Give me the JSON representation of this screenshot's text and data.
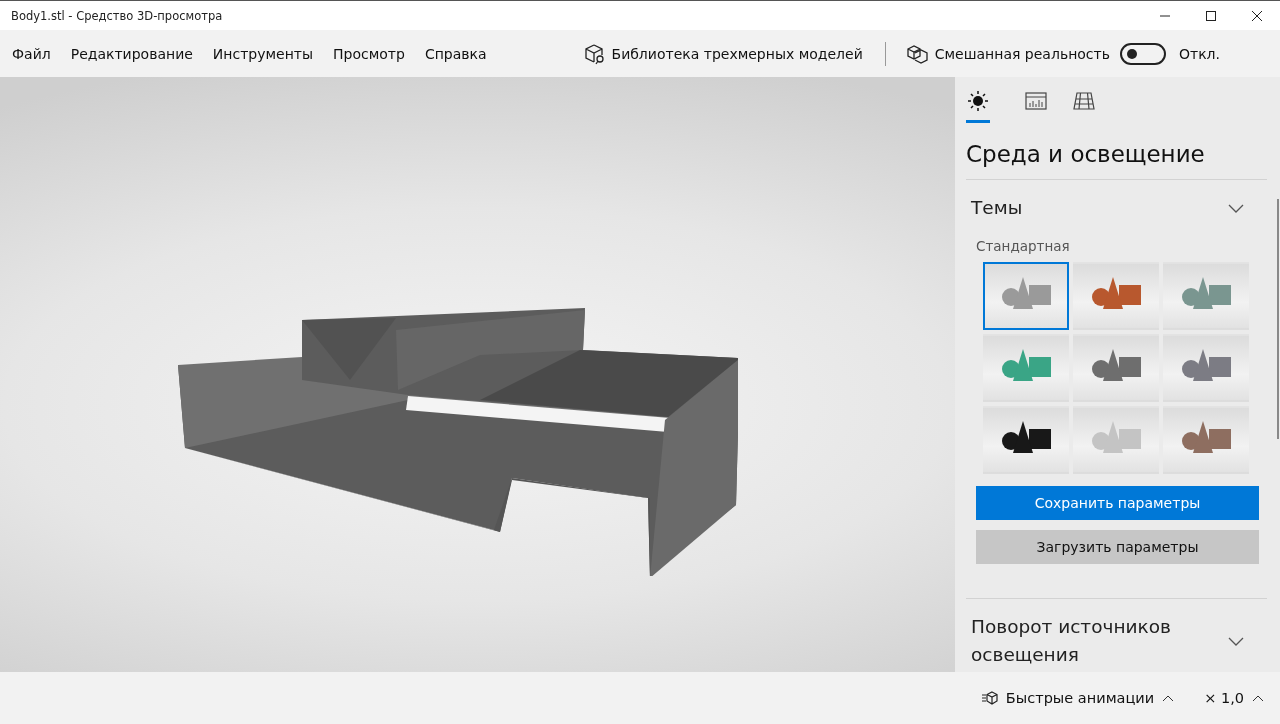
{
  "window": {
    "title": "Body1.stl - Средство 3D-просмотра"
  },
  "menu": [
    "Файл",
    "Редактирование",
    "Инструменты",
    "Просмотр",
    "Справка"
  ],
  "library": {
    "label": "Библиотека трехмерных моделей"
  },
  "mixed_reality": {
    "label": "Смешанная реальность",
    "on": false,
    "state_text": "Откл."
  },
  "panel": {
    "tabs": [
      {
        "kind": "lighting",
        "selected": true
      },
      {
        "kind": "stats",
        "selected": false
      },
      {
        "kind": "grid",
        "selected": false
      }
    ],
    "title": "Среда и освещение",
    "sections": [
      {
        "title": "Темы",
        "subtitle": "Стандартная",
        "themes": [
          {
            "color": "#9a9a9a",
            "selected": true
          },
          {
            "color": "#b8582e",
            "selected": false
          },
          {
            "color": "#7a9690",
            "selected": false
          },
          {
            "color": "#3aa586",
            "selected": false
          },
          {
            "color": "#6e6e6e",
            "selected": false
          },
          {
            "color": "#7c7c84",
            "selected": false
          },
          {
            "color": "#181818",
            "selected": false
          },
          {
            "color": "#c4c4c4",
            "selected": false
          },
          {
            "color": "#8e6e60",
            "selected": false
          }
        ],
        "buttons": [
          {
            "label": "Сохранить параметры",
            "kind": "primary"
          },
          {
            "label": "Загрузить параметры",
            "kind": "secondary"
          }
        ]
      },
      {
        "title": "Поворот источников освещения"
      }
    ]
  },
  "status_bar": {
    "animations": "Быстрые анимации",
    "speed": "× 1,0"
  }
}
